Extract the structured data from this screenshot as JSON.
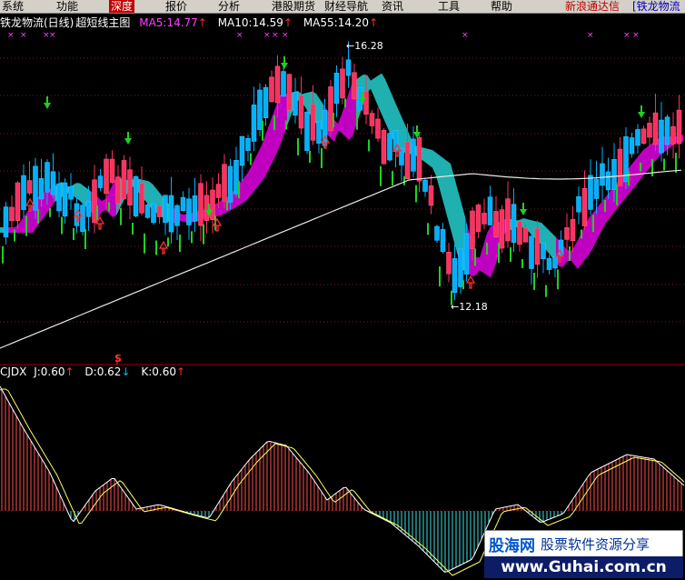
{
  "menu": {
    "items": [
      "系统",
      "功能",
      "深度",
      "报价",
      "分析",
      "港股期货",
      "财经导航",
      "资讯",
      "工具",
      "帮助"
    ],
    "active_index": 2,
    "news_link": "新浪通达信",
    "stock_link": "[铁龙物流"
  },
  "main_panel": {
    "title": "铁龙物流(日线)",
    "indicator_name": "超短线主图",
    "ma5_label": "MA5:14.77",
    "ma10_label": "MA10:14.59",
    "ma55_label": "MA55:14.20",
    "high_marker": "16.28",
    "low_marker": "12.18",
    "colors": {
      "ma5": "#ff40ff",
      "ma10": "#ffffff",
      "ma55": "#ffffff",
      "arrow": "#ff3030",
      "up_candle": "#ff3060",
      "down_candle": "#00b0ff"
    }
  },
  "sub_panel": {
    "indicator": "CJDX",
    "j_label": "J:0.60",
    "d_label": "D:0.62",
    "k_label": "K:0.60",
    "signal_marker": "S"
  },
  "watermark": {
    "brand": "股海网",
    "slogan": "股票软件资源分享",
    "url": "www.Guhai.com.cn"
  },
  "chart_data": {
    "type": "candlestick",
    "title": "铁龙物流(日线)",
    "moving_averages": [
      {
        "name": "MA5",
        "value": 14.77
      },
      {
        "name": "MA10",
        "value": 14.59
      },
      {
        "name": "MA55",
        "value": 14.2
      }
    ],
    "annotations": [
      {
        "label": "16.28",
        "kind": "period-high"
      },
      {
        "label": "12.18",
        "kind": "period-low"
      }
    ],
    "indicator": {
      "name": "CJDX",
      "J": 0.6,
      "D": 0.62,
      "K": 0.6
    }
  }
}
